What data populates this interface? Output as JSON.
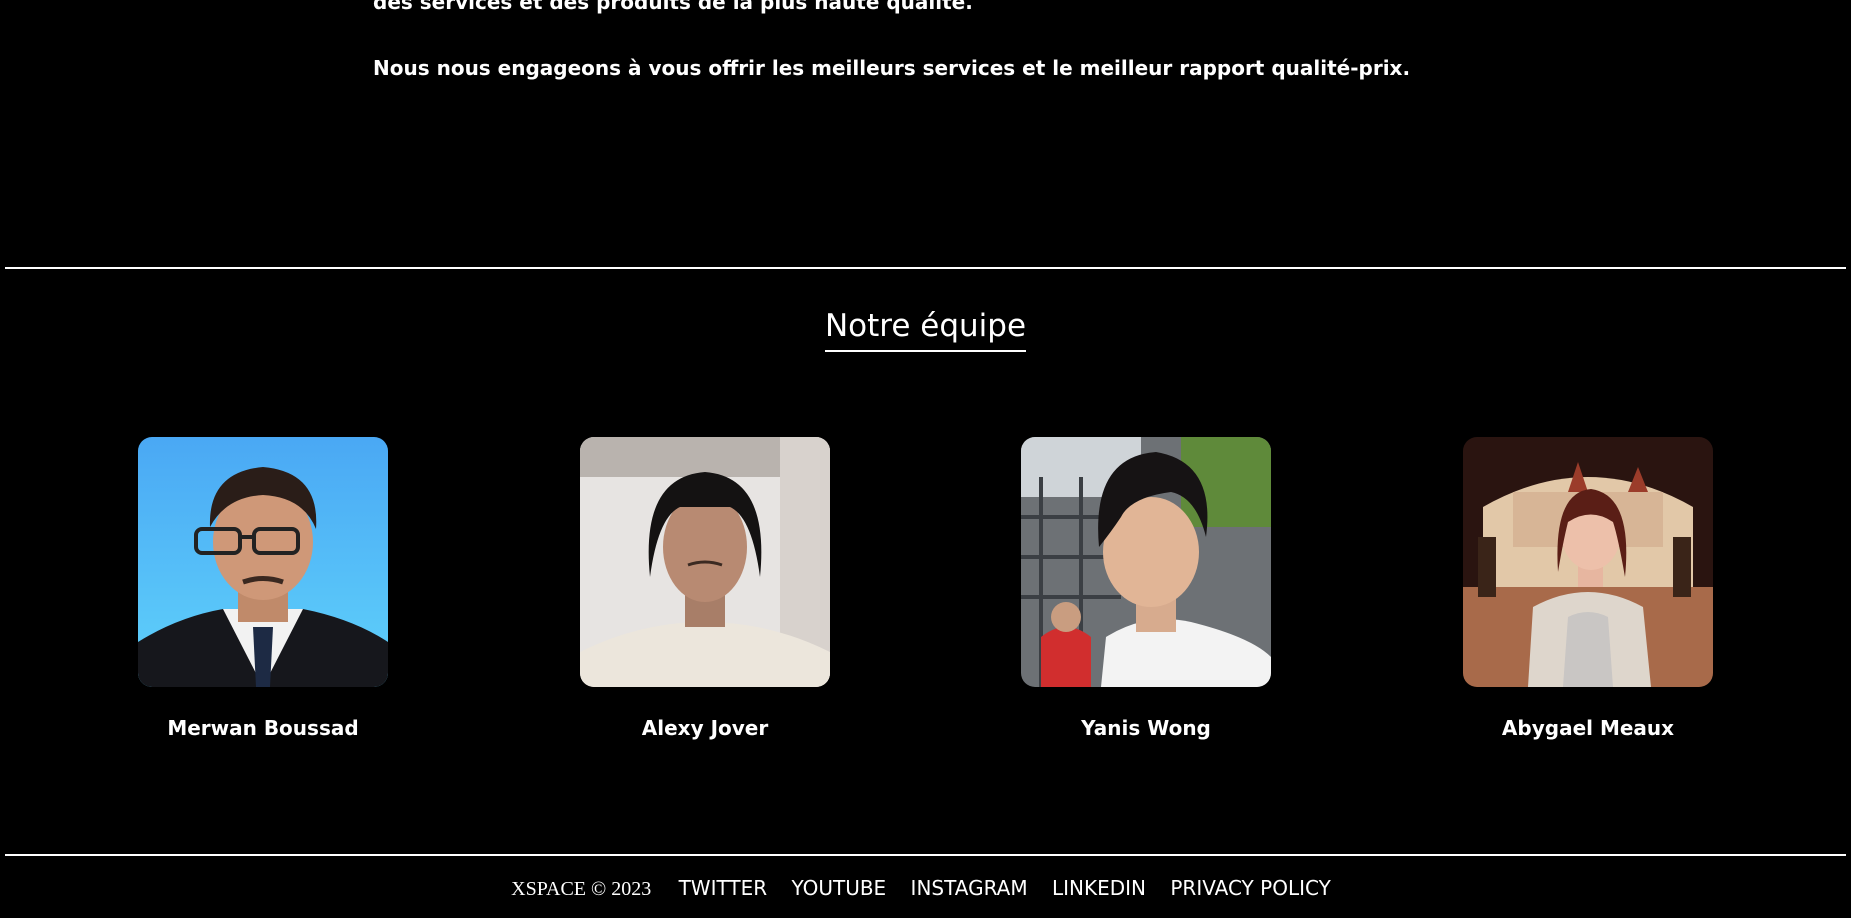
{
  "about": {
    "line1": "des services et des produits de la plus haute qualité.",
    "line2": "Nous nous engageons à vous offrir les meilleurs services et le meilleur rapport qualité-prix."
  },
  "team": {
    "title": "Notre équipe",
    "members": [
      {
        "name": "Merwan Boussad"
      },
      {
        "name": "Alexy Jover"
      },
      {
        "name": "Yanis Wong"
      },
      {
        "name": "Abygael Meaux"
      }
    ]
  },
  "footer": {
    "brand": "XSPACE © 2023",
    "links": [
      "TWITTER",
      "YOUTUBE",
      "INSTAGRAM",
      "LINKEDIN",
      "PRIVACY POLICY"
    ]
  },
  "colors": {
    "background": "#000000",
    "text": "#ffffff"
  }
}
